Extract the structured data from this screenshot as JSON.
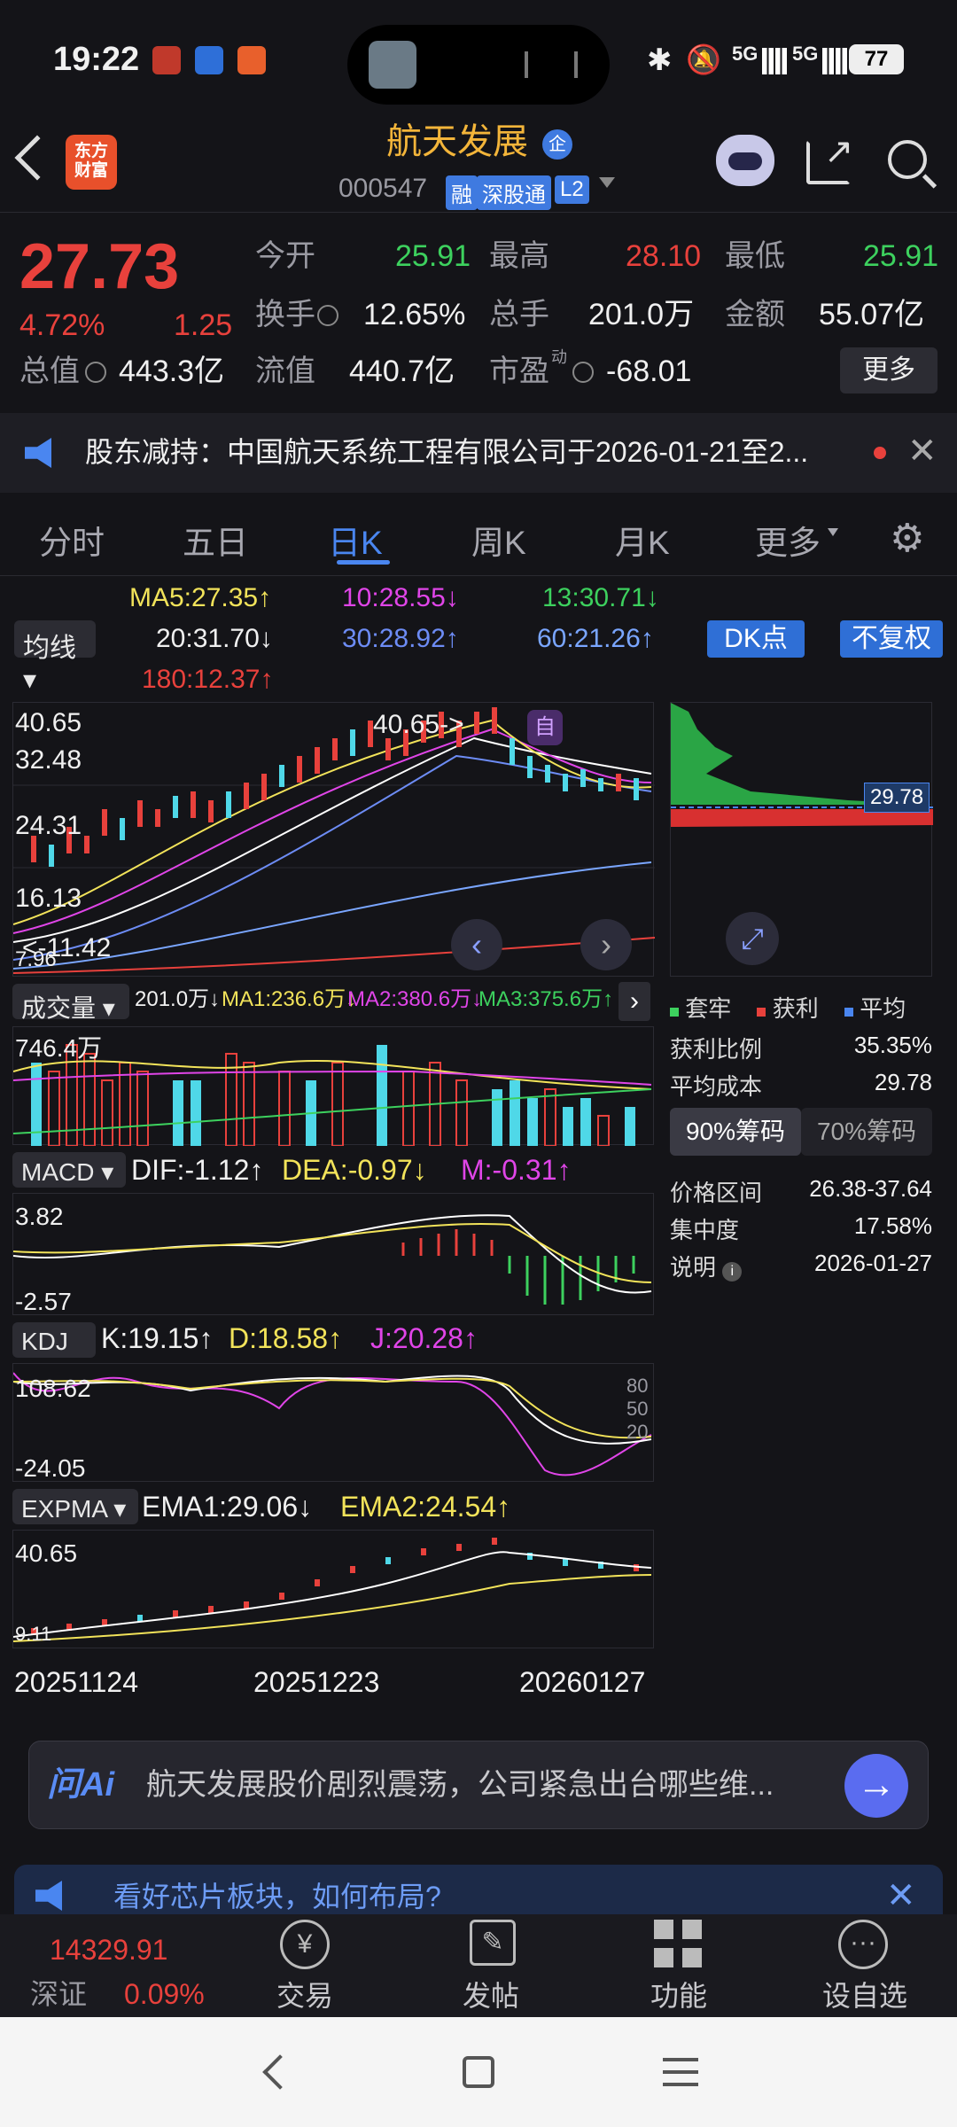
{
  "status_bar": {
    "time": "19:22",
    "battery": "77",
    "net1": "5G",
    "net2": "5G"
  },
  "header": {
    "title": "航天发展",
    "tag_enterprise": "企",
    "code": "000547",
    "badge_margin": "融",
    "badge_connect": "深股通",
    "badge_level": "L2",
    "logo_line1": "东方",
    "logo_line2": "财富"
  },
  "quote": {
    "price": "27.73",
    "pct": "4.72%",
    "change": "1.25",
    "open_label": "今开",
    "open": "25.91",
    "high_label": "最高",
    "high": "28.10",
    "low_label": "最低",
    "low": "25.91",
    "turnover_label": "换手",
    "turnover": "12.65%",
    "volume_label": "总手",
    "volume": "201.0万",
    "amount_label": "金额",
    "amount": "55.07亿",
    "mktcap_label": "总值",
    "mktcap": "443.3亿",
    "float_label": "流值",
    "float": "440.7亿",
    "pe_label": "市盈",
    "pe_sup": "动",
    "pe": "-68.01",
    "more_label": "更多"
  },
  "notice": {
    "text": "股东减持：中国航天系统工程有限公司于2026-01-21至2..."
  },
  "tabs": [
    "分时",
    "五日",
    "日K",
    "周K",
    "月K",
    "更多"
  ],
  "active_tab": 2,
  "ma": {
    "dropdown": "均线",
    "ma5": "MA5:27.35↑",
    "ma10": "10:28.55↓",
    "ma13": "13:30.71↓",
    "ma20": "20:31.70↓",
    "ma30": "30:28.92↑",
    "ma60": "60:21.26↑",
    "ma180": "180:12.37↑",
    "dk_label": "DK点",
    "fq_label": "不复权"
  },
  "kline": {
    "y_top": "40.65",
    "y2": "32.48",
    "y3": "24.31",
    "y4": "16.13",
    "y5": "7.96",
    "high_mark": "40.65->",
    "low_mark": "<-11.42",
    "self_tag": "自"
  },
  "chips": {
    "price_line": "29.78",
    "legend_trapped": "套牢",
    "legend_profit": "获利",
    "legend_avg": "平均",
    "profit_ratio_label": "获利比例",
    "profit_ratio": "35.35%",
    "avg_cost_label": "平均成本",
    "avg_cost": "29.78",
    "tab90": "90%筹码",
    "tab70": "70%筹码",
    "range_label": "价格区间",
    "range": "26.38-37.64",
    "conc_label": "集中度",
    "conc": "17.58%",
    "note_label": "说明",
    "note": "2026-01-27"
  },
  "volume": {
    "dropdown": "成交量",
    "val": "201.0万↓",
    "ma1": "MA1:236.6万↓",
    "ma2": "MA2:380.6万↓",
    "ma3": "MA3:375.6万↑",
    "y_top": "746.4万"
  },
  "macd": {
    "dropdown": "MACD",
    "dif": "DIF:-1.12↑",
    "dea": "DEA:-0.97↓",
    "m": "M:-0.31↑",
    "y_top": "3.82",
    "y_bot": "-2.57"
  },
  "kdj": {
    "dropdown": "KDJ",
    "k": "K:19.15↑",
    "d": "D:18.58↑",
    "j": "J:20.28↑",
    "y_top": "108.62",
    "y_bot": "-24.05",
    "l80": "80",
    "l50": "50",
    "l20": "20"
  },
  "expma": {
    "dropdown": "EXPMA",
    "ema1": "EMA1:29.06↓",
    "ema2": "EMA2:24.54↑",
    "y_top": "40.65",
    "y_bot": "9.11"
  },
  "dates": [
    "20251124",
    "20251223",
    "20260127"
  ],
  "ai": {
    "logo": "问Ai",
    "prompt": "航天发展股价剧烈震荡，公司紧急出台哪些维..."
  },
  "promo": {
    "text": "看好芯片板块，如何布局?"
  },
  "bottom_nav": {
    "index_value": "14329.91",
    "index_name": "深证",
    "index_pct": "0.09%",
    "trade": "交易",
    "post": "发帖",
    "func": "功能",
    "watch": "设自选"
  }
}
